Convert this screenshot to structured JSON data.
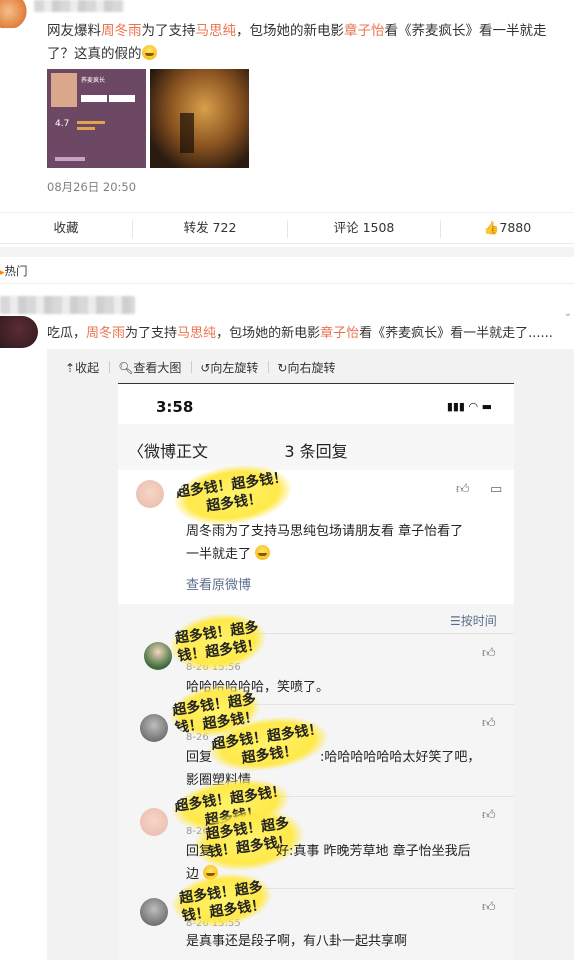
{
  "post": {
    "text_prefix": "网友爆料",
    "name1": "周冬雨",
    "text_mid1": "为了支持",
    "name2": "马思纯",
    "text_mid2": "，包场她的新电影",
    "name3": "章子怡",
    "text_mid3": "看《荞麦疯长》看一半就走了？这真的假的",
    "thumb1_title": "荞麦疯长",
    "thumb1_rating": "4.7",
    "time": "08月26日 20:50"
  },
  "actions": {
    "collect": "收藏",
    "repost": "转发 722",
    "comment": "评论 1508",
    "like": "7880"
  },
  "hot_label": "热门",
  "comment": {
    "text_prefix": "吃瓜，",
    "name1": "周冬雨",
    "text_mid1": "为了支持",
    "name2": "马思纯",
    "text_mid2": "，包场她的新电影",
    "name3": "章子怡",
    "text_mid3": "看《荞麦疯长》看一半就走了......"
  },
  "viewer_tools": {
    "collapse": "收起",
    "view_large": "查看大图",
    "rotate_left": "向左旋转",
    "rotate_right": "向右旋转"
  },
  "phone": {
    "status_time": "3:58",
    "nav_back": "微博正文",
    "nav_title": "3 条回复",
    "sticker_text": "超多钱！超多钱！超多钱！",
    "orig_text_line1": "周冬雨为了支持马思纯包场请朋友看 章子怡看了",
    "orig_text_line2": "一半就走了",
    "view_original": "查看原微博",
    "sort_label": "按时间",
    "replies": [
      {
        "time": "8-26 15:56",
        "text": "哈哈哈哈哈哈，笑喷了。"
      },
      {
        "time": "8-26",
        "text_line1": "回复",
        "text_tail": ":哈哈哈哈哈哈太好笑了吧，",
        "text_line2": "影圈塑料情"
      },
      {
        "time": "8-26",
        "text_line1": "回复",
        "text_tail": "好:真事 昨晚芳草地 章子怡坐我后",
        "text_line2": "边"
      },
      {
        "time": "8-26 15:55",
        "text": "是真事还是段子啊，有八卦一起共享啊"
      }
    ]
  }
}
